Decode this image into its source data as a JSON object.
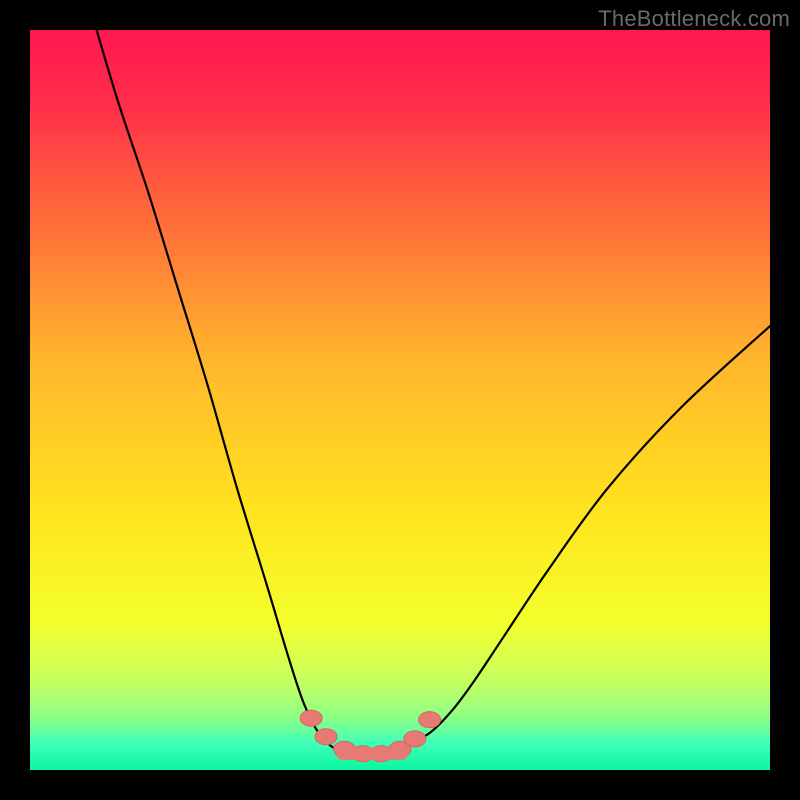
{
  "watermark": "TheBottleneck.com",
  "colors": {
    "frame": "#000000",
    "curve": "#000000",
    "marker_fill": "#e77a74",
    "marker_stroke": "#d66560",
    "gradient_stops": [
      {
        "offset": 0.0,
        "color": "#ff1750"
      },
      {
        "offset": 0.1,
        "color": "#ff2e4a"
      },
      {
        "offset": 0.25,
        "color": "#ff6a3a"
      },
      {
        "offset": 0.45,
        "color": "#ffb72c"
      },
      {
        "offset": 0.65,
        "color": "#ffe31e"
      },
      {
        "offset": 0.8,
        "color": "#f4ff2c"
      },
      {
        "offset": 0.88,
        "color": "#c6ff60"
      },
      {
        "offset": 0.93,
        "color": "#8bff87"
      },
      {
        "offset": 0.965,
        "color": "#3dffb8"
      },
      {
        "offset": 1.0,
        "color": "#0bf6a0"
      }
    ]
  },
  "chart_data": {
    "type": "line",
    "title": "",
    "xlabel": "",
    "ylabel": "",
    "xlim": [
      0,
      100
    ],
    "ylim": [
      0,
      100
    ],
    "grid": false,
    "legend": false,
    "series": [
      {
        "name": "bottleneck-curve",
        "x": [
          9,
          12,
          16,
          20,
          24,
          28,
          32,
          35,
          37,
          39,
          41,
          43,
          45,
          47,
          49,
          51,
          54,
          57,
          60,
          64,
          70,
          78,
          88,
          100
        ],
        "y": [
          100,
          90,
          78,
          65,
          52,
          38,
          25,
          15,
          9,
          5,
          3,
          2,
          2,
          2,
          2.5,
          3.5,
          5,
          8,
          12,
          18,
          27,
          38,
          49,
          60
        ]
      }
    ],
    "markers": {
      "name": "highlighted-points",
      "x": [
        38,
        40,
        42.5,
        45,
        47.5,
        50,
        52,
        54
      ],
      "y": [
        7,
        4.5,
        2.8,
        2.2,
        2.2,
        2.8,
        4.2,
        6.8
      ]
    }
  }
}
